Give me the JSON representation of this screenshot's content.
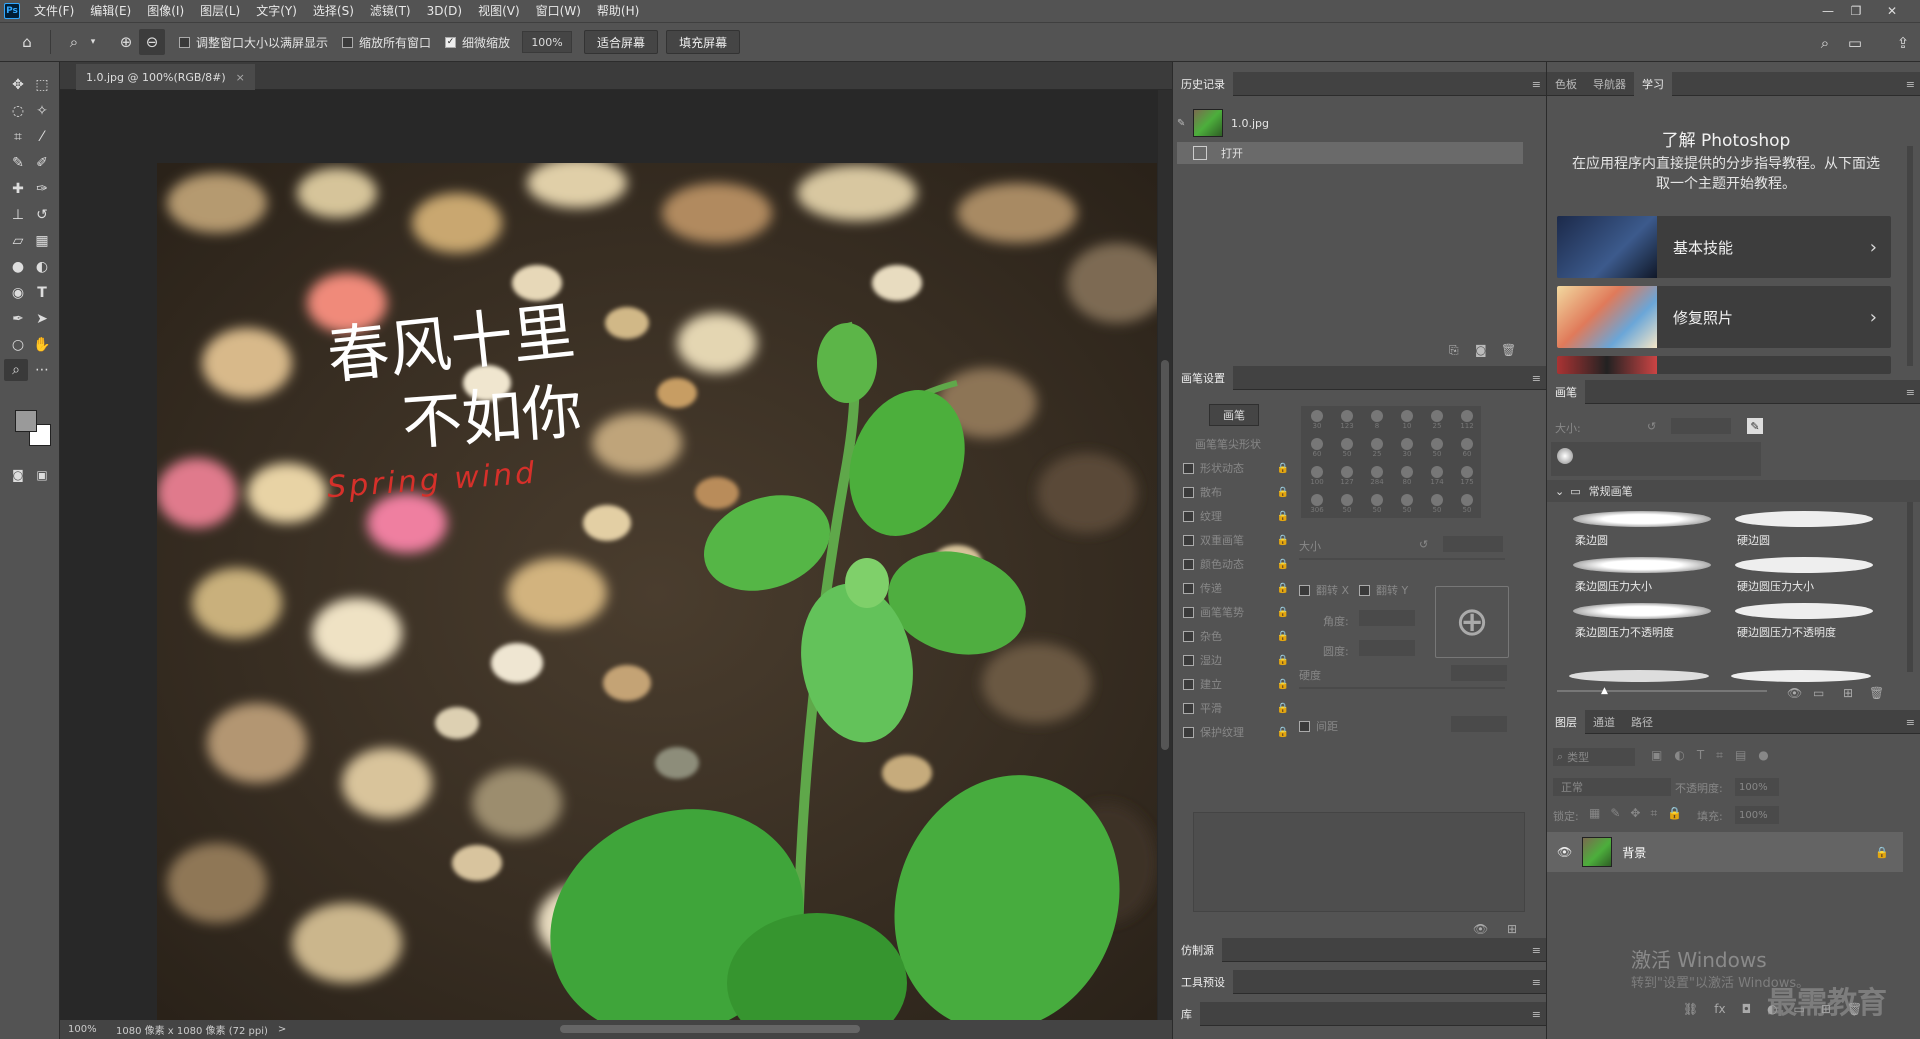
{
  "app": {
    "logo": "Ps"
  },
  "menubar": {
    "items": [
      "文件(F)",
      "编辑(E)",
      "图像(I)",
      "图层(L)",
      "文字(Y)",
      "选择(S)",
      "滤镜(T)",
      "3D(D)",
      "视图(V)",
      "窗口(W)",
      "帮助(H)"
    ],
    "minimize": "—",
    "restore": "❐",
    "close": "✕"
  },
  "options": {
    "resize_windows": "调整窗口大小以满屏显示",
    "zoom_all": "缩放所有窗口",
    "scrubby_zoom": "细微缩放",
    "zoom_value": "100%",
    "fit_screen": "适合屏幕",
    "fill_screen": "填充屏幕"
  },
  "document": {
    "tab_title": "1.0.jpg @ 100%(RGB/8#)",
    "close": "×",
    "calligraphy_line1": "春风十里",
    "calligraphy_line2": "不如你",
    "spring_wind": "Spring wind"
  },
  "status": {
    "zoom": "100%",
    "size": "1080 像素 x 1080 像素 (72 ppi)",
    "arrow": ">"
  },
  "history": {
    "tab": "历史记录",
    "snapshot": "1.0.jpg",
    "step": "打开"
  },
  "brush_settings": {
    "tab": "画笔设置",
    "brushes_btn": "画笔",
    "tip_shape": "画笔笔尖形状",
    "options": [
      "形状动态",
      "散布",
      "纹理",
      "双重画笔",
      "颜色动态",
      "传递",
      "画笔笔势",
      "杂色",
      "湿边",
      "建立",
      "平滑",
      "保护纹理"
    ],
    "preset_sizes": [
      "30",
      "123",
      "8",
      "10",
      "25",
      "112",
      "60",
      "50",
      "25",
      "30",
      "50",
      "60",
      "100",
      "127",
      "284",
      "80",
      "174",
      "175",
      "306",
      "50",
      "50",
      "50",
      "50",
      "50"
    ],
    "size": "大小",
    "flip_x": "翻转 X",
    "flip_y": "翻转 Y",
    "angle": "角度:",
    "roundness": "圆度:",
    "hardness": "硬度",
    "spacing": "间距"
  },
  "collapsed_panels": [
    "仿制源",
    "工具预设",
    "库"
  ],
  "learn": {
    "tabs": [
      "色板",
      "导航器",
      "学习"
    ],
    "title": "了解 Photoshop",
    "description": "在应用程序内直接提供的分步指导教程。从下面选取一个主题开始教程。",
    "cards": [
      "基本技能",
      "修复照片"
    ]
  },
  "brushes": {
    "tab": "画笔",
    "size_label": "大小:",
    "group": "常规画笔",
    "items": [
      "柔边圆",
      "硬边圆",
      "柔边圆压力大小",
      "硬边圆压力大小",
      "柔边圆压力不透明度",
      "硬边圆压力不透明度"
    ]
  },
  "layers": {
    "tabs": [
      "图层",
      "通道",
      "路径"
    ],
    "filter": "类型",
    "blend": "正常",
    "opacity_label": "不透明度:",
    "opacity": "100%",
    "lock_label": "锁定:",
    "fill_label": "填充:",
    "fill": "100%",
    "layer_name": "背景"
  },
  "watermark": {
    "activate": "激活 Windows",
    "hint": "转到\"设置\"以激活 Windows。",
    "brand": "最需教育"
  }
}
